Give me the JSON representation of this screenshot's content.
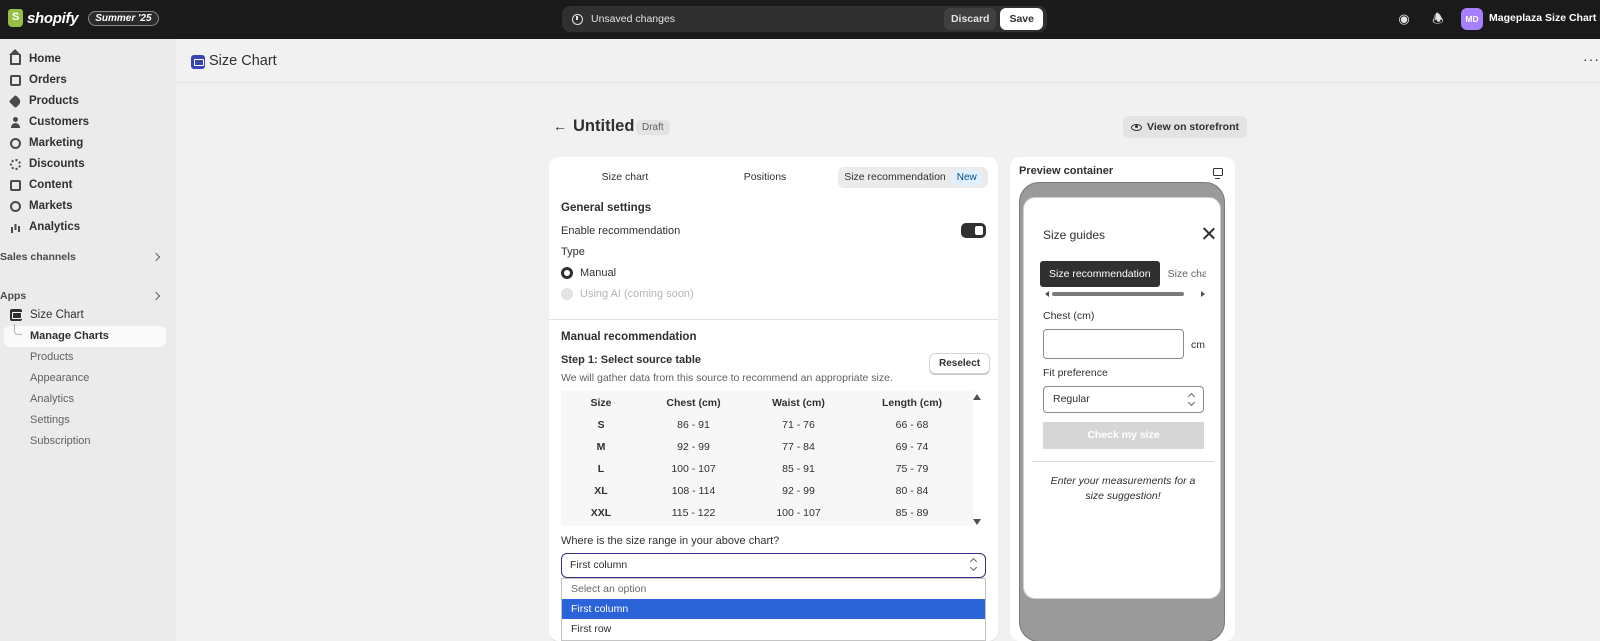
{
  "topbar": {
    "brand": "shopify",
    "badge": "Summer '25",
    "unsaved_text": "Unsaved changes",
    "discard_label": "Discard",
    "save_label": "Save",
    "avatar_initials": "MD",
    "store_name": "Mageplaza Size Chart De..."
  },
  "sidebar": {
    "items": [
      {
        "label": "Home",
        "icon": "home-icon"
      },
      {
        "label": "Orders",
        "icon": "orders-icon"
      },
      {
        "label": "Products",
        "icon": "tag-icon"
      },
      {
        "label": "Customers",
        "icon": "person-icon"
      },
      {
        "label": "Marketing",
        "icon": "target-icon"
      },
      {
        "label": "Discounts",
        "icon": "discount-icon"
      },
      {
        "label": "Content",
        "icon": "content-icon"
      },
      {
        "label": "Markets",
        "icon": "globe-icon"
      },
      {
        "label": "Analytics",
        "icon": "bar-chart-icon"
      }
    ],
    "sales_channels_label": "Sales channels",
    "apps_label": "Apps",
    "app_name": "Size Chart",
    "app_subitems": [
      "Manage Charts",
      "Products",
      "Appearance",
      "Analytics",
      "Settings",
      "Subscription"
    ]
  },
  "page": {
    "title": "Size Chart",
    "more": "···"
  },
  "editor": {
    "back": "←",
    "title": "Untitled",
    "status": "Draft",
    "view_storefront": "View on storefront",
    "tabs": [
      "Size chart",
      "Positions",
      "Size recommendation"
    ],
    "new_badge": "New",
    "general_settings": "General settings",
    "enable_recommendation": "Enable recommendation",
    "enable_recommendation_on": true,
    "type_label": "Type",
    "type_options": [
      "Manual",
      "Using AI (coming soon)"
    ],
    "type_selected": "Manual",
    "manual_recommendation": "Manual recommendation",
    "step1_title": "Step 1: Select source table",
    "step1_help": "We will gather data from this source to recommend an appropriate size.",
    "reselect_label": "Reselect",
    "table": {
      "headers": [
        "Size",
        "Chest (cm)",
        "Waist (cm)",
        "Length (cm)"
      ],
      "rows": [
        [
          "S",
          "86 - 91",
          "71 - 76",
          "66 - 68"
        ],
        [
          "M",
          "92 - 99",
          "77 - 84",
          "69 - 74"
        ],
        [
          "L",
          "100 - 107",
          "85 - 91",
          "75 - 79"
        ],
        [
          "XL",
          "108 - 114",
          "92 - 99",
          "80 - 84"
        ],
        [
          "XXL",
          "115 - 122",
          "100 - 107",
          "85 - 89"
        ]
      ]
    },
    "size_range_question": "Where is the size range in your above chart?",
    "size_range_value": "First column",
    "size_range_options": [
      "Select an option",
      "First column",
      "First row"
    ]
  },
  "preview": {
    "title": "Preview container",
    "modal_title": "Size guides",
    "tab_active": "Size recommendation",
    "tab_other": "Size chart",
    "chest_label": "Chest (cm)",
    "chest_value": "",
    "unit": "cm",
    "fit_label": "Fit preference",
    "fit_value": "Regular",
    "check_button": "Check my size",
    "hint": "Enter your measurements for a size suggestion!"
  }
}
